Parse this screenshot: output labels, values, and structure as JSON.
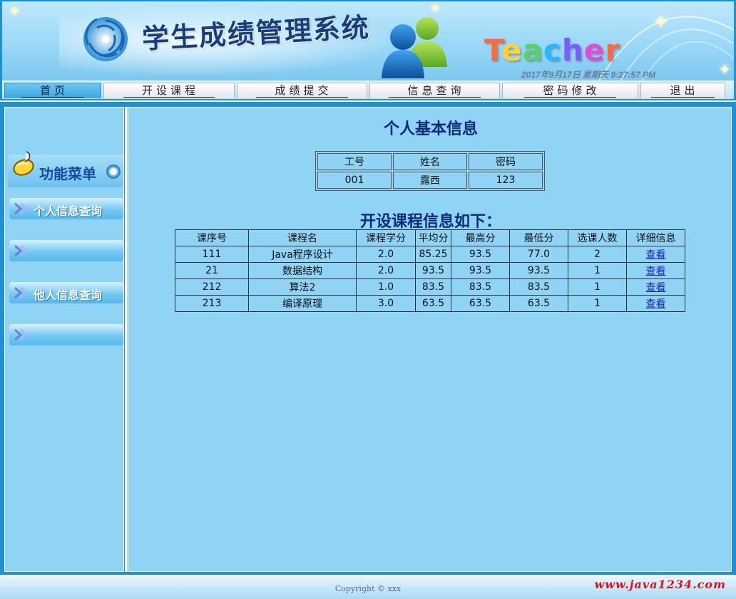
{
  "header": {
    "system_title": "学生成绩管理系统",
    "role_word": "Teacher",
    "datetime": "2017年9月17日 星期天 9:27:57 PM",
    "role_colors": [
      "#ff6a3d",
      "#ffd23a",
      "#5ad16a",
      "#2ab6ff",
      "#7a5cff",
      "#e04bd6",
      "#ff6a3d"
    ]
  },
  "nav": {
    "tabs": [
      {
        "label": "首页"
      },
      {
        "label": "开设课程"
      },
      {
        "label": "成绩提交"
      },
      {
        "label": "信息查询"
      },
      {
        "label": "密码修改"
      },
      {
        "label": "退出"
      }
    ]
  },
  "sidebar": {
    "title": "功能菜单",
    "items": [
      {
        "label": "个人信息查询"
      },
      {
        "label": ""
      },
      {
        "label": "他人信息查询"
      },
      {
        "label": ""
      }
    ]
  },
  "main": {
    "info_title": "个人基本信息",
    "info_headers": [
      "工号",
      "姓名",
      "密码"
    ],
    "info_values": [
      "001",
      "露西",
      "123"
    ],
    "course_title": "开设课程信息如下：",
    "course_headers": [
      "课序号",
      "课程名",
      "课程学分",
      "平均分",
      "最高分",
      "最低分",
      "选课人数",
      "详细信息"
    ],
    "courses": [
      [
        "111",
        "Java程序设计",
        "2.0",
        "85.25",
        "93.5",
        "77.0",
        "2",
        "查看"
      ],
      [
        "21",
        "数据结构",
        "2.0",
        "93.5",
        "93.5",
        "93.5",
        "1",
        "查看"
      ],
      [
        "212",
        "算法2",
        "1.0",
        "83.5",
        "83.5",
        "83.5",
        "1",
        "查看"
      ],
      [
        "213",
        "编译原理",
        "3.0",
        "63.5",
        "63.5",
        "63.5",
        "1",
        "查看"
      ]
    ]
  },
  "footer": {
    "copyright": "Copyright © xxx",
    "site": "www.java1234.com"
  }
}
